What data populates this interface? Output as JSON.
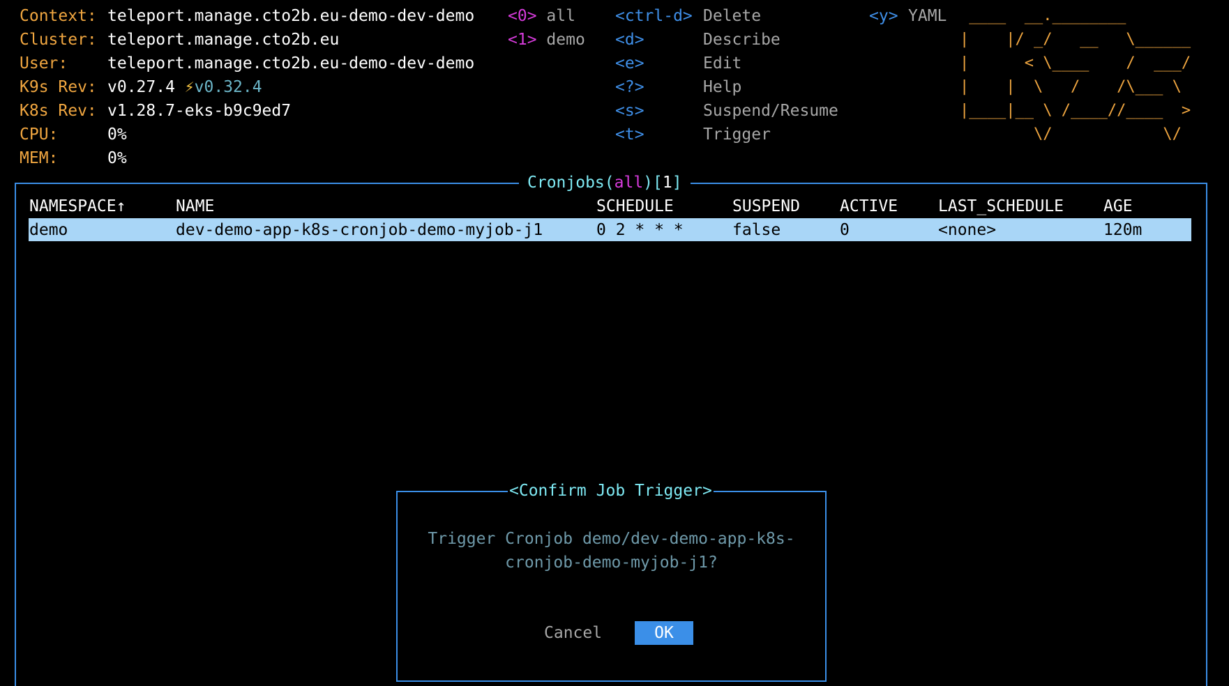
{
  "info": {
    "context_label": "Context:",
    "context": "teleport.manage.cto2b.eu-demo-dev-demo",
    "cluster_label": "Cluster:",
    "cluster": "teleport.manage.cto2b.eu",
    "user_label": "User:",
    "user": "teleport.manage.cto2b.eu-demo-dev-demo",
    "k9s_rev_label": "K9s Rev:",
    "k9s_rev": "v0.27.4",
    "k9s_rev_new": "v0.32.4",
    "k8s_rev_label": "K8s Rev:",
    "k8s_rev": "v1.28.7-eks-b9c9ed7",
    "cpu_label": "CPU:",
    "cpu": "0%",
    "mem_label": "MEM:",
    "mem": "0%"
  },
  "namespaces": [
    {
      "key": "<0>",
      "name": "all"
    },
    {
      "key": "<1>",
      "name": "demo"
    }
  ],
  "commands": [
    {
      "key": "<ctrl-d>",
      "desc": "Delete"
    },
    {
      "key": "<d>",
      "desc": "Describe"
    },
    {
      "key": "<e>",
      "desc": "Edit"
    },
    {
      "key": "<?>",
      "desc": "Help"
    },
    {
      "key": "<s>",
      "desc": "Suspend/Resume"
    },
    {
      "key": "<t>",
      "desc": "Trigger"
    }
  ],
  "extra_command": {
    "key": "<y>",
    "desc": "YAML"
  },
  "logo_lines": [
    " ____  __.________",
    "|    |/ _/   __   \\______",
    "|      < \\____    /  ___/",
    "|    |  \\   /    /\\___ \\",
    "|____|__ \\ /____//____  >",
    "        \\/            \\/"
  ],
  "table": {
    "title_resource": "Cronjobs(",
    "title_filter": "all",
    "title_close": ")[",
    "title_count": "1",
    "title_end": "]",
    "headers": {
      "namespace": "NAMESPACE↑",
      "name": "NAME",
      "schedule": "SCHEDULE",
      "suspend": "SUSPEND",
      "active": "ACTIVE",
      "last_schedule": "LAST_SCHEDULE",
      "age": "AGE"
    },
    "rows": [
      {
        "namespace": "demo",
        "name": "dev-demo-app-k8s-cronjob-demo-myjob-j1",
        "schedule": "0 2 * * *",
        "suspend": "false",
        "active": "0",
        "last_schedule": "<none>",
        "age": "120m"
      }
    ]
  },
  "dialog": {
    "title": "<Confirm Job Trigger>",
    "message": "Trigger Cronjob demo/dev-demo-app-k8s-\ncronjob-demo-myjob-j1?",
    "cancel_label": "Cancel",
    "ok_label": "OK"
  },
  "colors": {
    "label": "#f0a640",
    "ns_key": "#d63bdb",
    "cmd_key": "#3f8fe8",
    "border": "#3b8fe8",
    "title": "#7ee9f3",
    "selected_row": "#a9d6f7",
    "ok_button": "#3b8fe8"
  }
}
